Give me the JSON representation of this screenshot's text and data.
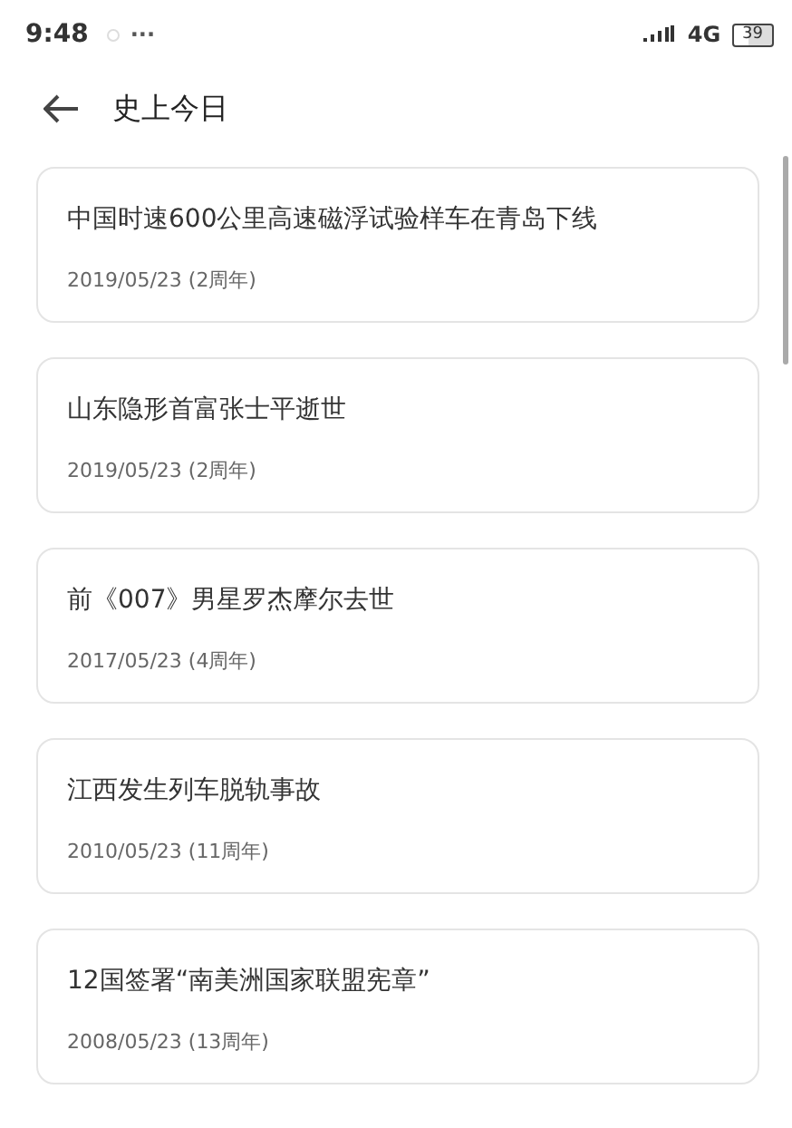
{
  "status_bar": {
    "time": "9:48",
    "more": "···",
    "network": "4G",
    "battery": "39"
  },
  "header": {
    "title": "史上今日"
  },
  "events": [
    {
      "title": "中国时速600公里高速磁浮试验样车在青岛下线",
      "date": "2019/05/23 (2周年)"
    },
    {
      "title": "山东隐形首富张士平逝世",
      "date": "2019/05/23 (2周年)"
    },
    {
      "title": "前《007》男星罗杰摩尔去世",
      "date": "2017/05/23 (4周年)"
    },
    {
      "title": "江西发生列车脱轨事故",
      "date": "2010/05/23 (11周年)"
    },
    {
      "title": "12国签署“南美洲国家联盟宪章”",
      "date": "2008/05/23 (13周年)"
    }
  ]
}
